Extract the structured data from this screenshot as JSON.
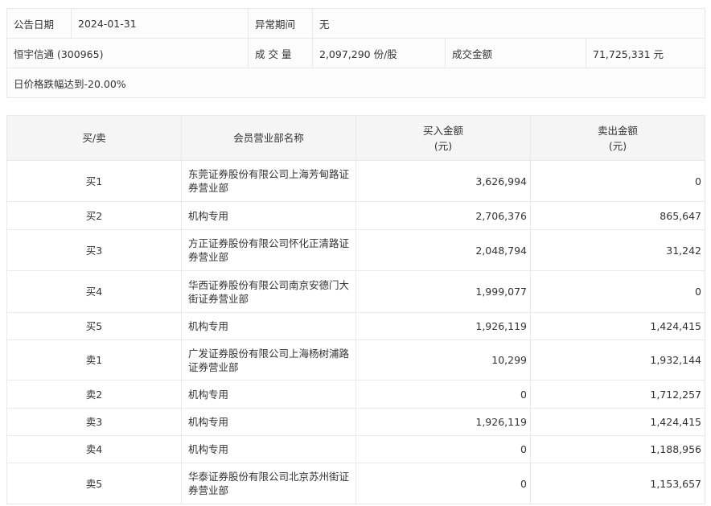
{
  "info": {
    "date_label": "公告日期",
    "date": "2024-01-31",
    "period_label": "异常期间",
    "period": "无",
    "stock": "恒宇信通 (300965)",
    "volume_label": "成 交 量",
    "volume": "2,097,290 份/股",
    "amount_label": "成交金额",
    "amount": "71,725,331 元",
    "reason": "日价格跌幅达到-20.00%"
  },
  "table": {
    "headers": [
      "买/卖",
      "会员营业部名称",
      "买入金额\n(元)",
      "卖出金额\n(元)"
    ],
    "rows": [
      {
        "side": "买1",
        "name": "东莞证券股份有限公司上海芳甸路证券营业部",
        "buy": "3,626,994",
        "sell": "0"
      },
      {
        "side": "买2",
        "name": "机构专用",
        "buy": "2,706,376",
        "sell": "865,647"
      },
      {
        "side": "买3",
        "name": "方正证券股份有限公司怀化正清路证券营业部",
        "buy": "2,048,794",
        "sell": "31,242"
      },
      {
        "side": "买4",
        "name": "华西证券股份有限公司南京安德门大街证券营业部",
        "buy": "1,999,077",
        "sell": "0"
      },
      {
        "side": "买5",
        "name": "机构专用",
        "buy": "1,926,119",
        "sell": "1,424,415"
      },
      {
        "side": "卖1",
        "name": "广发证券股份有限公司上海杨树浦路证券营业部",
        "buy": "10,299",
        "sell": "1,932,144"
      },
      {
        "side": "卖2",
        "name": "机构专用",
        "buy": "0",
        "sell": "1,712,257"
      },
      {
        "side": "卖3",
        "name": "机构专用",
        "buy": "1,926,119",
        "sell": "1,424,415"
      },
      {
        "side": "卖4",
        "name": "机构专用",
        "buy": "0",
        "sell": "1,188,956"
      },
      {
        "side": "卖5",
        "name": "华泰证券股份有限公司北京苏州街证券营业部",
        "buy": "0",
        "sell": "1,153,657"
      }
    ]
  }
}
